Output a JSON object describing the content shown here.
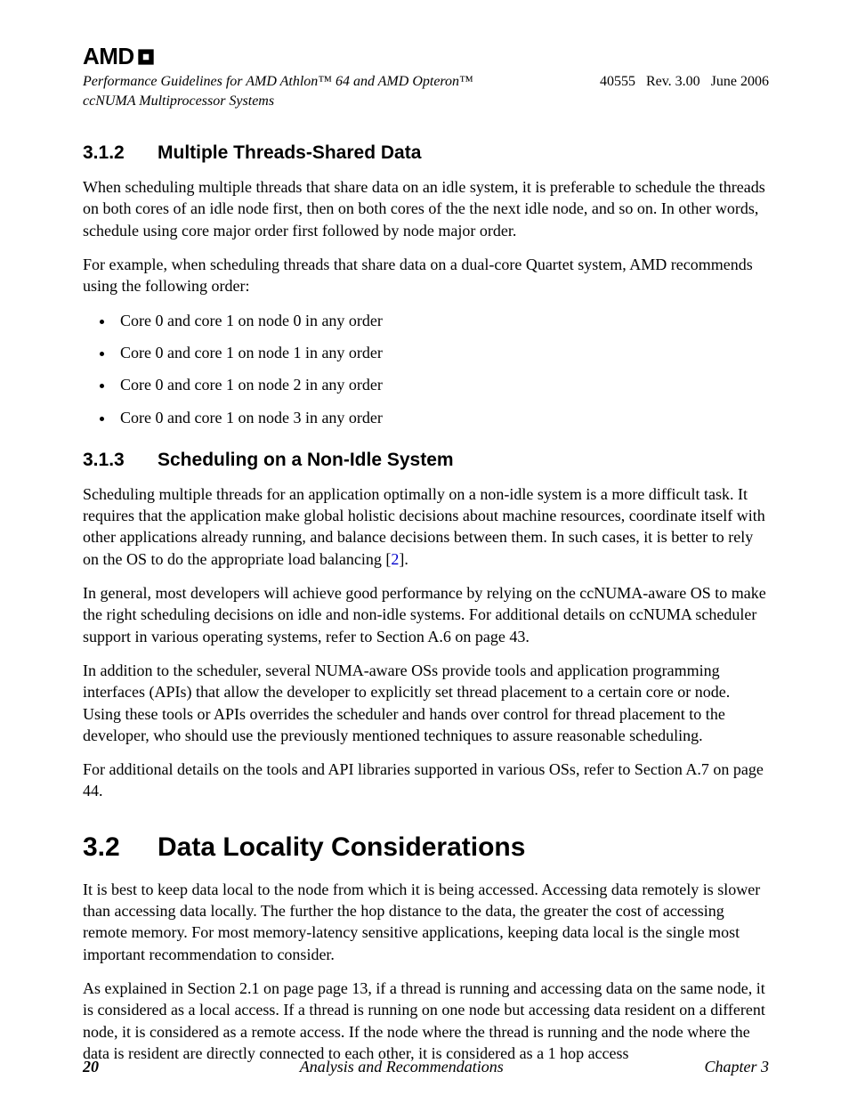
{
  "logo_text": "AMD",
  "logo_glyph": "⮏",
  "header": {
    "title_line1": "Performance Guidelines for AMD Athlon™ 64 and AMD Opteron™",
    "title_line2": "ccNUMA Multiprocessor Systems",
    "docnum": "40555",
    "rev": "Rev. 3.00",
    "date": "June 2006"
  },
  "sections": {
    "s312": {
      "num": "3.1.2",
      "title": "Multiple Threads-Shared Data",
      "p1": "When scheduling multiple threads that share data on an idle system, it is preferable to schedule the threads on both cores of an idle node first, then on both cores of the the next idle node, and so on. In other words, schedule using core major order first followed by node major order.",
      "p2": "For example, when scheduling threads that share data on a dual-core Quartet system, AMD recommends using the following order:",
      "bullets": [
        "Core 0 and core 1 on node 0 in any order",
        "Core 0 and core 1 on node 1 in any order",
        "Core 0 and core 1 on node 2 in any order",
        "Core 0 and core 1 on node 3 in any order"
      ]
    },
    "s313": {
      "num": "3.1.3",
      "title": "Scheduling on a Non-Idle System",
      "p1a": "Scheduling multiple threads for an application optimally on a non-idle system is a more difficult task. It requires that the application make global holistic decisions about machine resources, coordinate itself with other applications already running, and balance decisions between them. In such cases, it is better to rely on the OS to do the appropriate load balancing [",
      "p1ref": "2",
      "p1b": "].",
      "p2": "In general, most developers will achieve good performance by relying on the ccNUMA-aware OS to make the right scheduling decisions on idle and non-idle systems. For additional details on ccNUMA scheduler support in various operating systems, refer to Section A.6 on page 43.",
      "p3": "In addition to the scheduler, several NUMA-aware OSs provide tools and application programming interfaces (APIs) that allow the developer to explicitly set thread placement to a certain core or node. Using these tools or APIs overrides the scheduler and hands over control for thread placement to the developer, who should use the previously mentioned techniques to assure reasonable scheduling.",
      "p4": "For additional details on the tools and API libraries supported in various OSs, refer to Section A.7 on page 44."
    },
    "s32": {
      "num": "3.2",
      "title": "Data Locality Considerations",
      "p1": "It is best to keep data local to the node from which it is being accessed. Accessing data remotely is slower than accessing data locally. The further the hop distance to the data, the greater the cost of accessing remote memory. For most memory-latency sensitive applications, keeping data local is the single most important recommendation to consider.",
      "p2": "As explained in Section 2.1 on page page 13, if a thread is running and accessing data on the same node, it is considered as a local access. If a thread is running on one node but accessing data resident on a different node, it is considered as a remote access. If the node where the thread is running and the node where the data is resident are directly connected to each other, it is considered as a 1 hop access"
    }
  },
  "footer": {
    "page": "20",
    "title": "Analysis and Recommendations",
    "chapter": "Chapter 3"
  }
}
